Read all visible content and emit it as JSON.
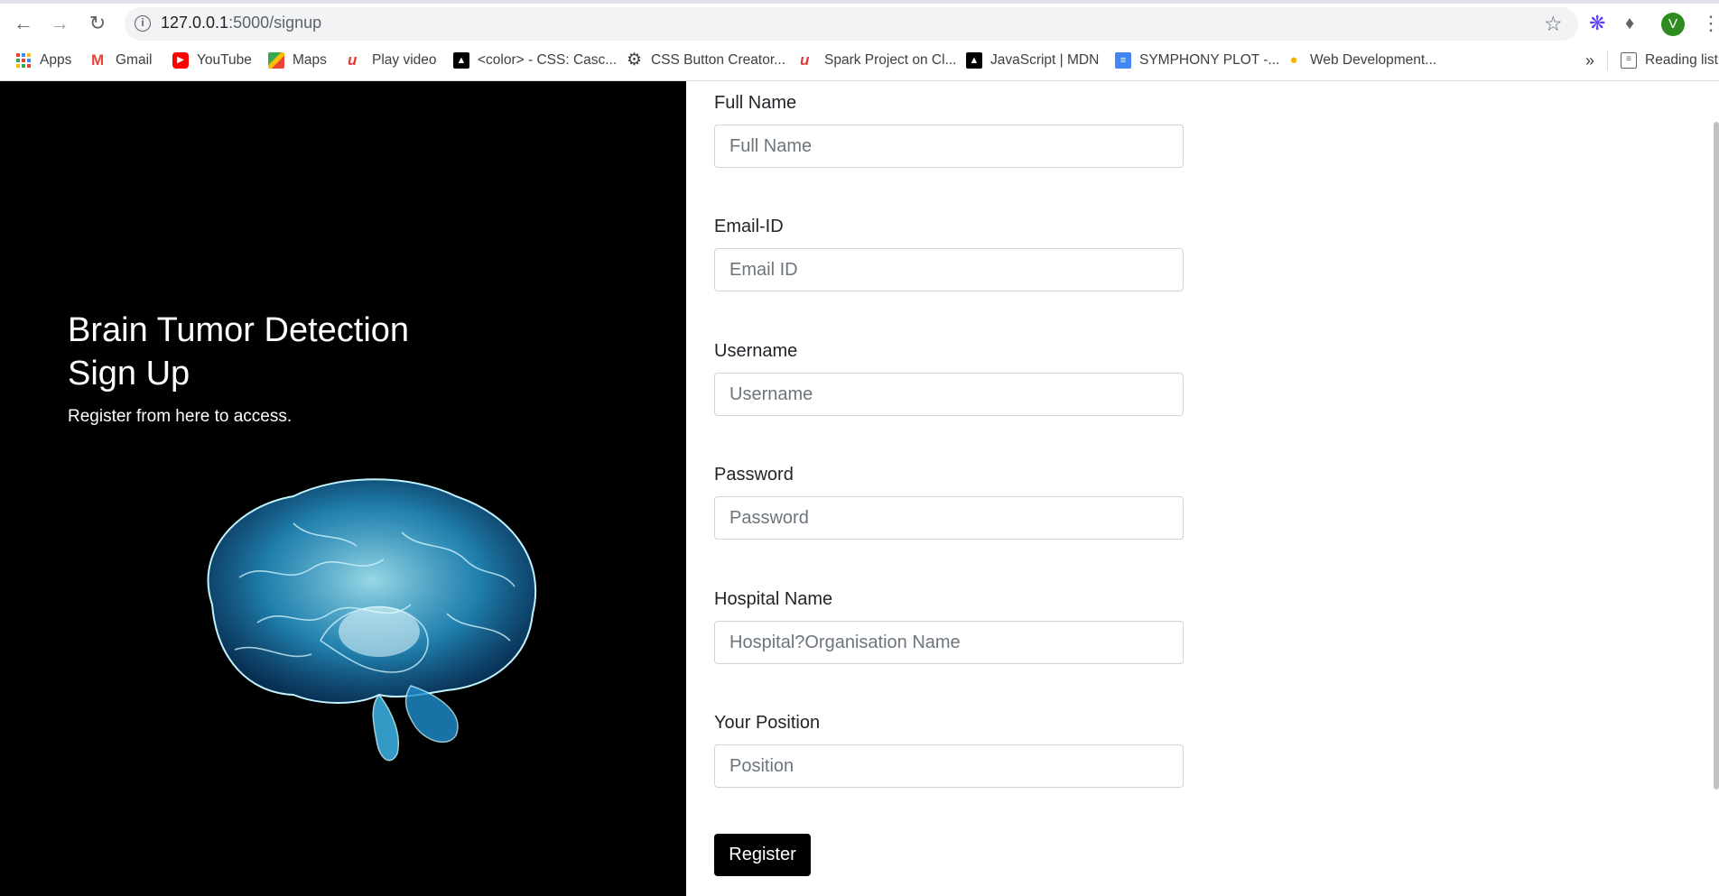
{
  "browser": {
    "url_host": "127.0.0.1",
    "url_path": ":5000/signup",
    "profile_initial": "V",
    "bookmarks": [
      {
        "label": "Apps",
        "icon": "apps-icon"
      },
      {
        "label": "Gmail",
        "icon": "gmail-icon"
      },
      {
        "label": "YouTube",
        "icon": "youtube-icon"
      },
      {
        "label": "Maps",
        "icon": "maps-icon"
      },
      {
        "label": "Play video",
        "icon": "play-video-icon"
      },
      {
        "label": "<color> - CSS: Casc...",
        "icon": "mdn-icon"
      },
      {
        "label": "CSS Button Creator...",
        "icon": "gear-icon"
      },
      {
        "label": "Spark Project on Cl...",
        "icon": "spark-icon"
      },
      {
        "label": "JavaScript | MDN",
        "icon": "mdn-icon"
      },
      {
        "label": "SYMPHONY PLOT -...",
        "icon": "docs-icon"
      },
      {
        "label": "Web Development...",
        "icon": "bulb-icon"
      }
    ],
    "more_bookmarks": "»",
    "reading_list": "Reading list"
  },
  "hero": {
    "title_line1": "Brain Tumor Detection",
    "title_line2": "Sign Up",
    "subtitle": "Register from here to access."
  },
  "form": {
    "fields": [
      {
        "label": "Full Name",
        "placeholder": "Full Name"
      },
      {
        "label": "Email-ID",
        "placeholder": "Email ID"
      },
      {
        "label": "Username",
        "placeholder": "Username"
      },
      {
        "label": "Password",
        "placeholder": "Password"
      },
      {
        "label": "Hospital Name",
        "placeholder": "Hospital?Organisation Name"
      },
      {
        "label": "Your Position",
        "placeholder": "Position"
      }
    ],
    "submit_label": "Register"
  }
}
